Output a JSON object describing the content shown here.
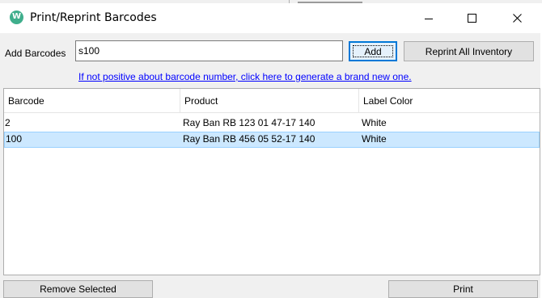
{
  "window": {
    "title": "Print/Reprint Barcodes",
    "icon_letter": "W",
    "icon_color": "#3fae8c",
    "controls": [
      "minimize-icon",
      "maximize-icon",
      "close-icon"
    ]
  },
  "add_section": {
    "label": "Add Barcodes",
    "input_value": "s100",
    "add_button": "Add",
    "reprint_button": "Reprint All Inventory"
  },
  "generate_link": "If not positive about barcode number, click here to generate a brand new one.",
  "table": {
    "columns": [
      "Barcode",
      "Product",
      "Label Color"
    ],
    "rows": [
      {
        "barcode": "2",
        "product": "Ray Ban RB 123 01 47-17 140",
        "label_color": "White",
        "selected": false
      },
      {
        "barcode": "100",
        "product": "Ray Ban RB 456 05 52-17 140",
        "label_color": "White",
        "selected": true
      }
    ]
  },
  "footer": {
    "remove_button": "Remove Selected",
    "print_button": "Print"
  },
  "colors": {
    "selection": "#cce8ff",
    "link": "#0000ff",
    "focus_border": "#0078d7"
  }
}
